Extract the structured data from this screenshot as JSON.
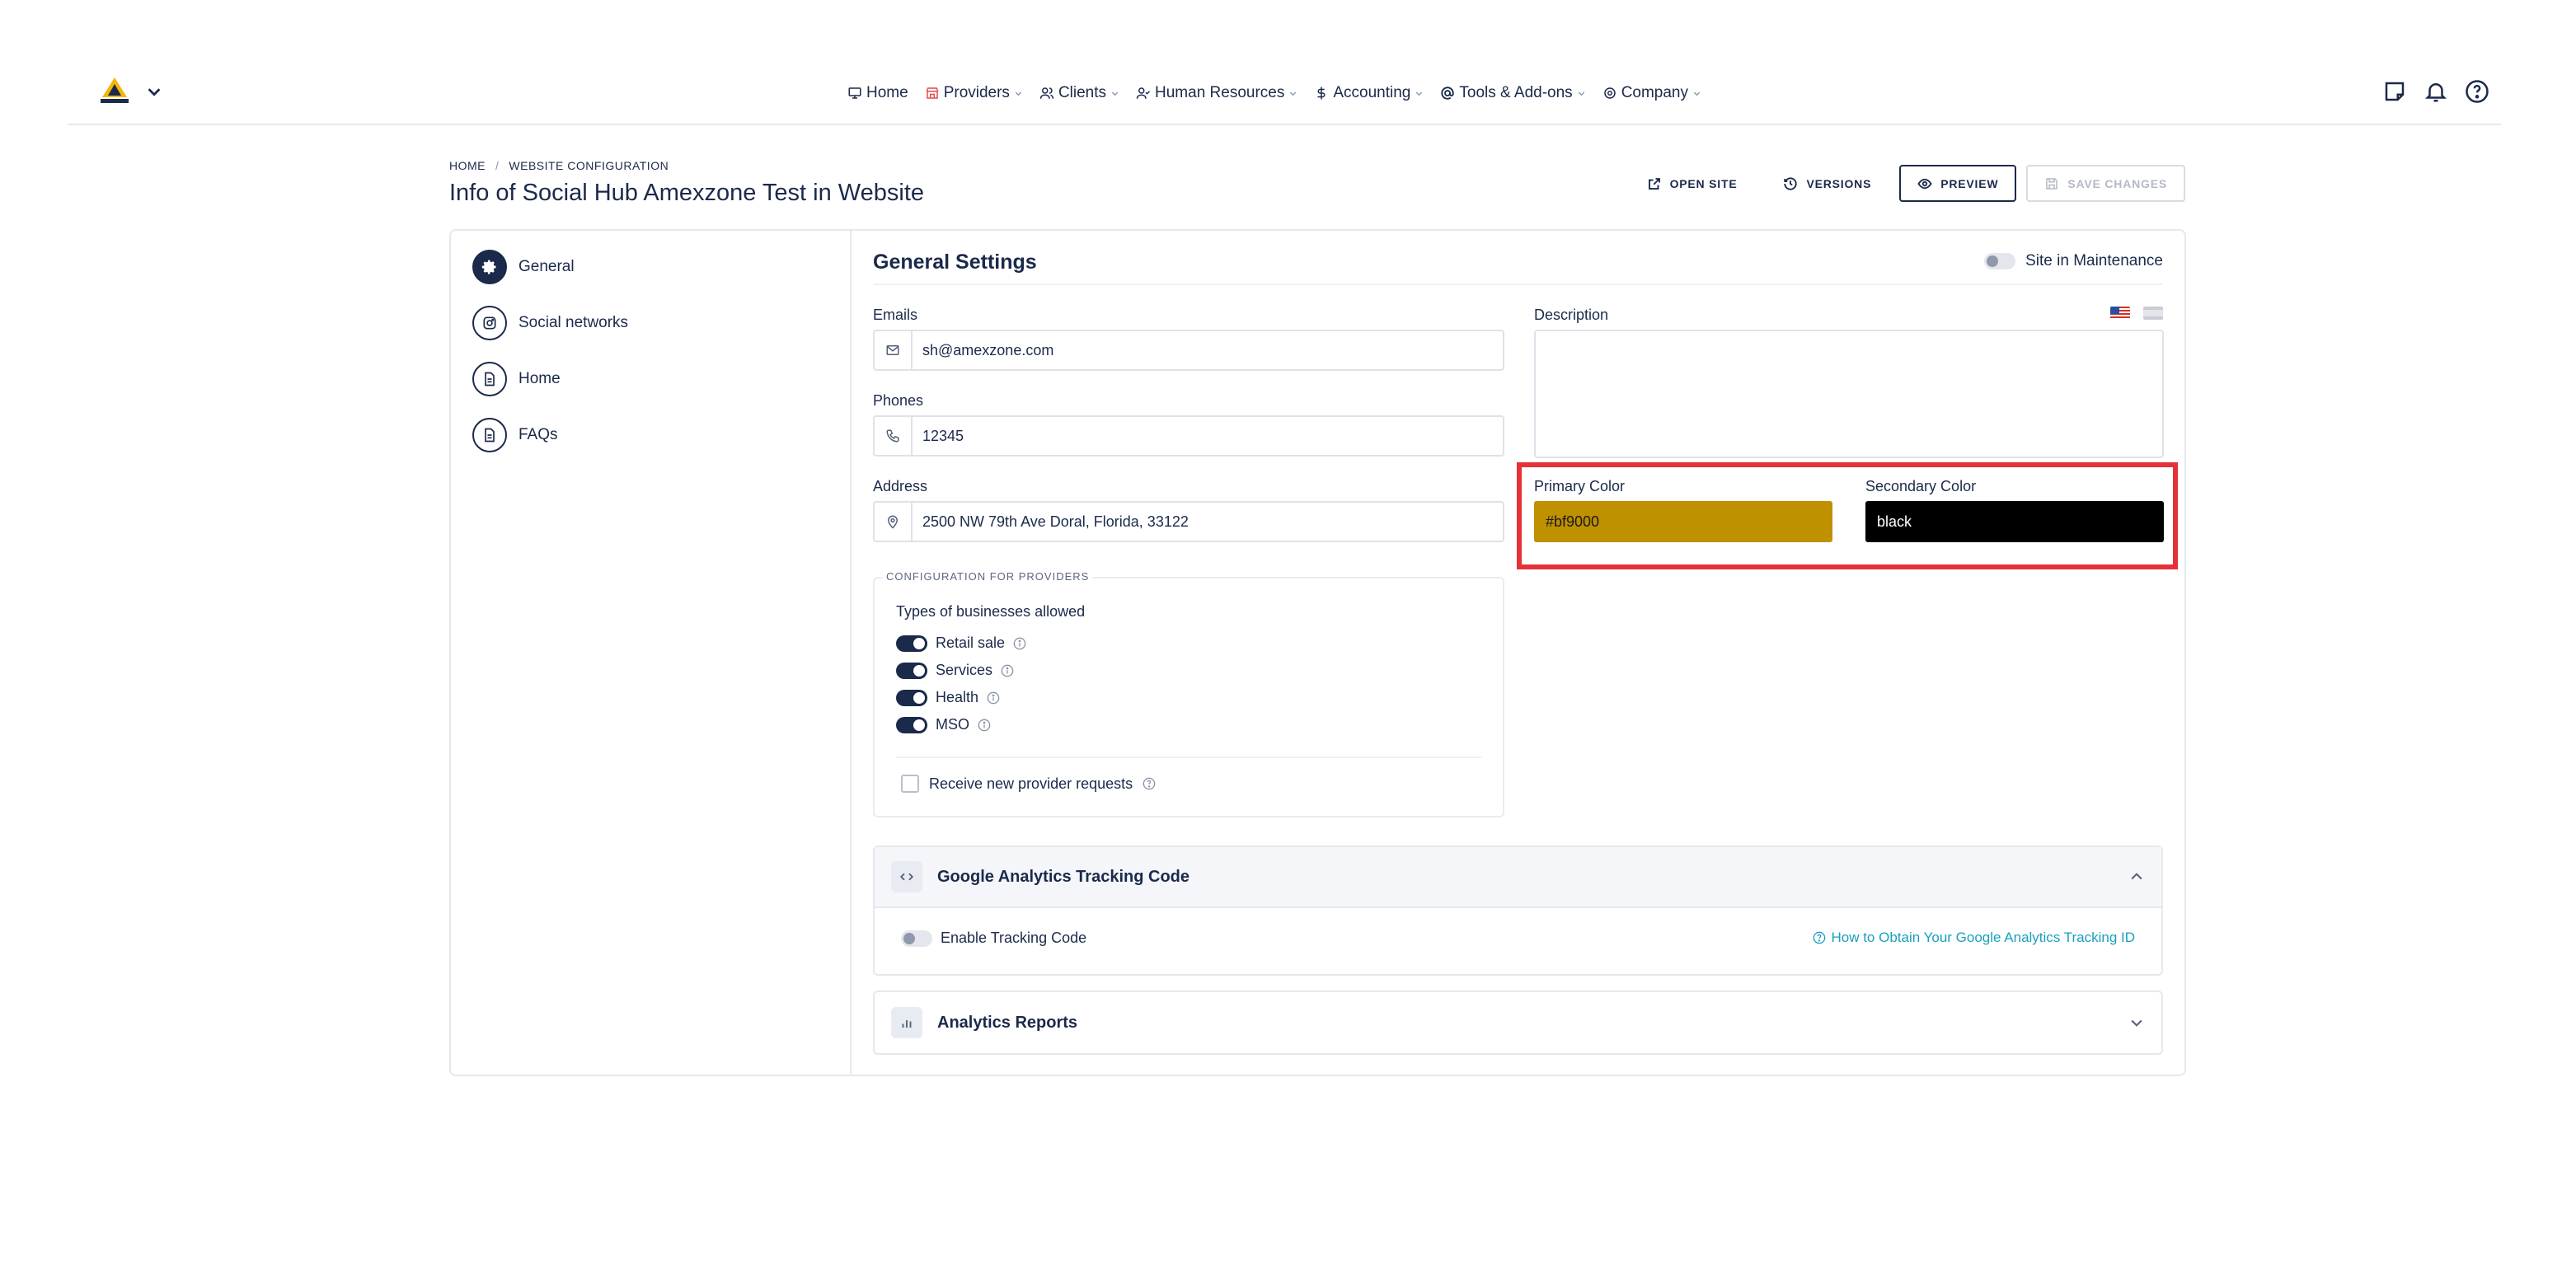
{
  "nav": {
    "items": [
      {
        "label": "Home",
        "icon": "monitor-icon"
      },
      {
        "label": "Providers",
        "icon": "store-icon"
      },
      {
        "label": "Clients",
        "icon": "users-icon"
      },
      {
        "label": "Human Resources",
        "icon": "user-check-icon"
      },
      {
        "label": "Accounting",
        "icon": "dollar-icon"
      },
      {
        "label": "Tools & Add-ons",
        "icon": "at-icon"
      },
      {
        "label": "Company",
        "icon": "gear-icon"
      }
    ]
  },
  "breadcrumb": {
    "home": "HOME",
    "sep": "/",
    "current": "WEBSITE CONFIGURATION"
  },
  "page_title": "Info of Social Hub Amexzone Test in Website",
  "actions": {
    "open_site": "OPEN SITE",
    "versions": "VERSIONS",
    "preview": "PREVIEW",
    "save": "SAVE CHANGES"
  },
  "sidebar": {
    "items": [
      {
        "label": "General",
        "icon": "gear-icon"
      },
      {
        "label": "Social networks",
        "icon": "instagram-icon"
      },
      {
        "label": "Home",
        "icon": "file-icon"
      },
      {
        "label": "FAQs",
        "icon": "file-icon"
      }
    ]
  },
  "general": {
    "title": "General Settings",
    "maintenance_label": "Site in Maintenance",
    "emails_label": "Emails",
    "emails_value": "sh@amexzone.com",
    "phones_label": "Phones",
    "phones_value": "12345",
    "address_label": "Address",
    "address_value": "2500 NW 79th Ave Doral, Florida, 33122",
    "description_label": "Description",
    "primary_color_label": "Primary Color",
    "primary_color_value": "#bf9000",
    "secondary_color_label": "Secondary Color",
    "secondary_color_value": "black"
  },
  "providers_config": {
    "legend": "CONFIGURATION FOR PROVIDERS",
    "types_title": "Types of businesses allowed",
    "types": [
      "Retail sale",
      "Services",
      "Health",
      "MSO"
    ],
    "receive_label": "Receive new provider requests"
  },
  "ga": {
    "title": "Google Analytics Tracking Code",
    "enable_label": "Enable Tracking Code",
    "help_link": "How to Obtain Your Google Analytics Tracking ID"
  },
  "reports": {
    "title": "Analytics Reports"
  },
  "colors": {
    "navy": "#1b2a4a",
    "primary": "#bf9000",
    "secondary": "#000000",
    "highlight": "#e53238",
    "link": "#1a9fbd"
  }
}
